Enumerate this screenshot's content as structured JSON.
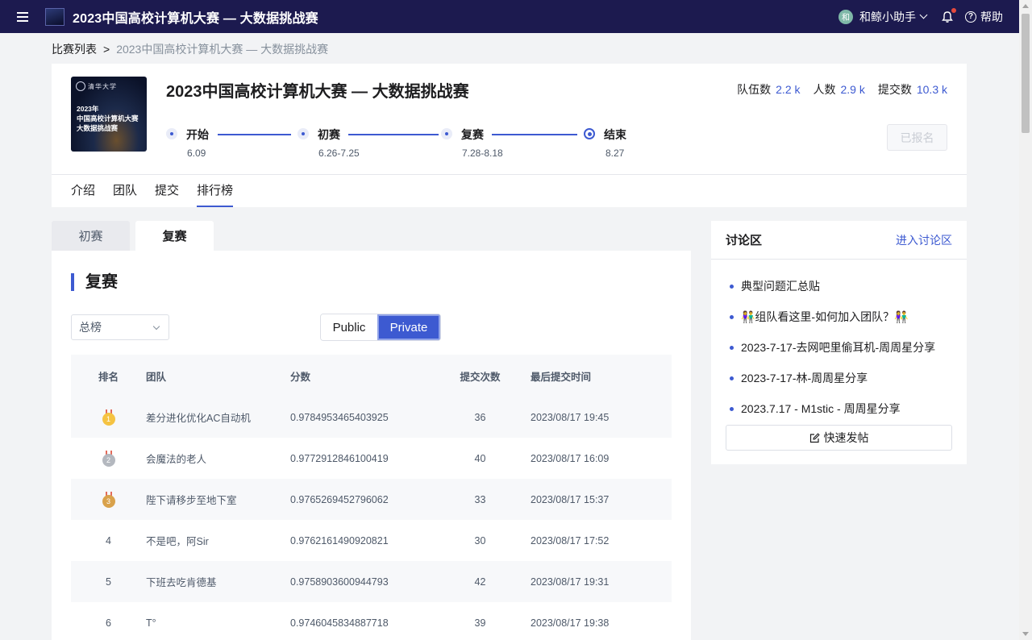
{
  "topbar": {
    "title": "2023中国高校计算机大赛 — 大数据挑战赛",
    "avatar_text": "和",
    "username": "和鲸小助手",
    "help_label": "帮助"
  },
  "breadcrumb": {
    "root": "比赛列表",
    "separator": ">",
    "current": "2023中国高校计算机大赛 — 大数据挑战赛"
  },
  "competition": {
    "cover_lines": [
      "2023年",
      "中国高校计算机大赛",
      "大数据挑战赛"
    ],
    "title": "2023中国高校计算机大赛 — 大数据挑战赛",
    "stats": [
      {
        "label": "队伍数",
        "value": "2.2 k"
      },
      {
        "label": "人数",
        "value": "2.9 k"
      },
      {
        "label": "提交数",
        "value": "10.3 k"
      }
    ],
    "timeline": [
      {
        "label": "开始",
        "date": "6.09"
      },
      {
        "label": "初赛",
        "date": "6.26-7.25"
      },
      {
        "label": "复赛",
        "date": "7.28-8.18"
      },
      {
        "label": "结束",
        "date": "8.27"
      }
    ],
    "register_button": "已报名",
    "tabs": [
      "介绍",
      "团队",
      "提交",
      "排行榜"
    ]
  },
  "leaderboard": {
    "round_tabs": [
      "初赛",
      "复赛"
    ],
    "section_title": "复赛",
    "select_value": "总榜",
    "segment": [
      "Public",
      "Private"
    ],
    "columns": [
      "排名",
      "团队",
      "分数",
      "提交次数",
      "最后提交时间"
    ],
    "rows": [
      {
        "rank": "1",
        "team": "差分进化优化AC自动机",
        "score": "0.9784953465403925",
        "count": "36",
        "time": "2023/08/17 19:45"
      },
      {
        "rank": "2",
        "team": "会魔法的老人",
        "score": "0.9772912846100419",
        "count": "40",
        "time": "2023/08/17 16:09"
      },
      {
        "rank": "3",
        "team": "陛下请移步至地下室",
        "score": "0.9765269452796062",
        "count": "33",
        "time": "2023/08/17 15:37"
      },
      {
        "rank": "4",
        "team": "不是吧，阿Sir",
        "score": "0.9762161490920821",
        "count": "30",
        "time": "2023/08/17 17:52"
      },
      {
        "rank": "5",
        "team": "下班去吃肯德基",
        "score": "0.9758903600944793",
        "count": "42",
        "time": "2023/08/17 19:31"
      },
      {
        "rank": "6",
        "team": "T°",
        "score": "0.9746045834887718",
        "count": "39",
        "time": "2023/08/17 19:38"
      }
    ]
  },
  "discussion": {
    "title": "讨论区",
    "link": "进入讨论区",
    "posts": [
      "典型问题汇总贴",
      "👫组队看这里-如何加入团队？👫",
      "2023-7-17-去网吧里偷耳机-周周星分享",
      "2023-7-17-林-周周星分享",
      "2023.7.17 - M1stic - 周周星分享"
    ],
    "quick_post": "快速发帖"
  },
  "colors": {
    "topbar": "#1c1a4f",
    "accent": "#3d5ad1"
  }
}
